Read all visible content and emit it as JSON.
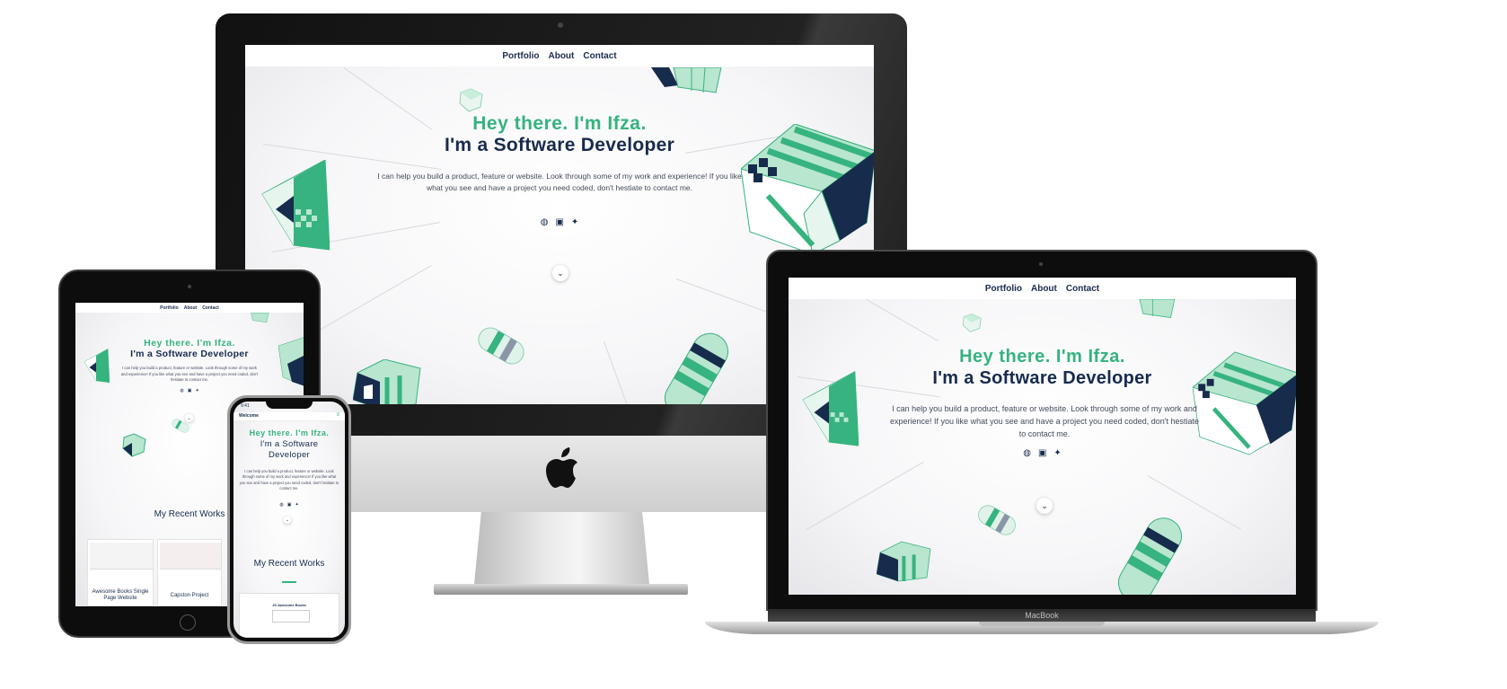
{
  "nav": {
    "portfolio": "Portfolio",
    "about": "About",
    "contact": "Contact"
  },
  "hero": {
    "greeting": "Hey there. I'm Ifza.",
    "role": "I'm a Software Developer",
    "description": "I can help you build a product, feature or website. Look through some of my work and experience! If you like what you see and have a project you need coded, don't hestiate to contact me."
  },
  "social": [
    "github-icon",
    "linkedin-icon",
    "twitter-icon"
  ],
  "works": {
    "title": "My Recent Works",
    "cards": [
      "Awesome Books Single Page Website",
      "Capston Project"
    ]
  },
  "phone": {
    "time": "9:41",
    "tab": "Welcome",
    "role_line1": "I'm a Software",
    "role_line2": "Developer",
    "card_title": "JS Awesome Books"
  },
  "laptop": {
    "brand": "MacBook"
  },
  "colors": {
    "green": "#36b37e",
    "navy": "#172b4d",
    "mint": "#b9e6cf"
  }
}
